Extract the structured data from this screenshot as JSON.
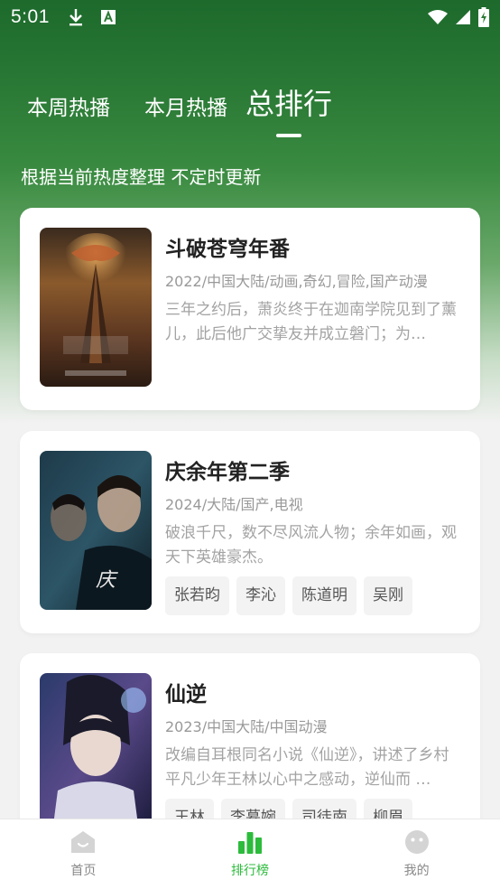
{
  "status_bar": {
    "time": "5:01"
  },
  "tabs": {
    "weekly": "本周热播",
    "monthly": "本月热播",
    "overall": "总排行"
  },
  "subtitle": "根据当前热度整理 不定时更新",
  "items": [
    {
      "title": "斗破苍穹年番",
      "meta": "2022/中国大陆/动画,奇幻,冒险,国产动漫",
      "desc": "三年之约后，萧炎终于在迦南学院见到了薰儿，此后他广交挚友并成立磐门；为…",
      "tags": []
    },
    {
      "title": "庆余年第二季",
      "meta": "2024/大陆/国产,电视",
      "desc": "破浪千尺，数不尽风流人物；余年如画，观天下英雄豪杰。",
      "tags": [
        "张若昀",
        "李沁",
        "陈道明",
        "吴刚"
      ]
    },
    {
      "title": "仙逆",
      "meta": "2023/中国大陆/中国动漫",
      "desc": "改编自耳根同名小说《仙逆》，讲述了乡村平凡少年王林以心中之感动，逆仙而 …",
      "tags": [
        "王林",
        "李慕婉",
        "司徒南",
        "柳眉"
      ]
    }
  ],
  "bottom_nav": {
    "home": "首页",
    "rank": "排行榜",
    "mine": "我的"
  },
  "colors": {
    "accent": "#2dbb3c",
    "header_green": "#2b7a36"
  }
}
